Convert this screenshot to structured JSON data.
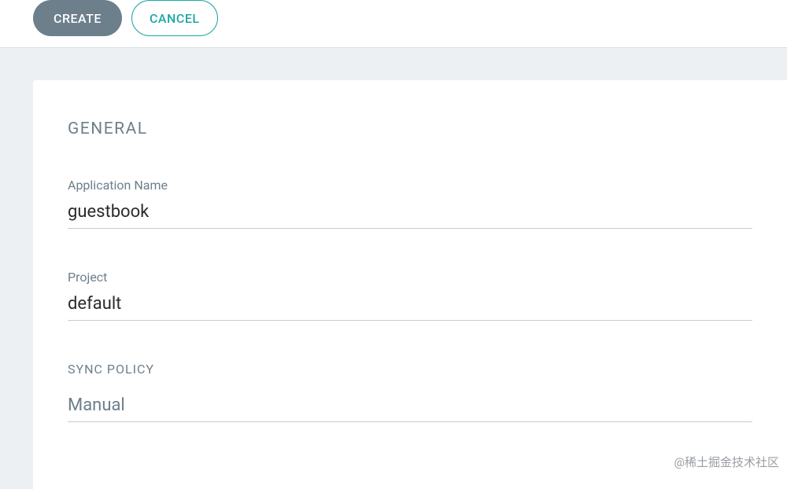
{
  "header": {
    "create_label": "CREATE",
    "cancel_label": "CANCEL"
  },
  "sections": {
    "general": {
      "heading": "GENERAL",
      "application_name": {
        "label": "Application Name",
        "value": "guestbook"
      },
      "project": {
        "label": "Project",
        "value": "default"
      }
    },
    "sync_policy": {
      "heading": "SYNC POLICY",
      "value": "Manual"
    }
  },
  "watermark": "@稀土掘金技术社区"
}
